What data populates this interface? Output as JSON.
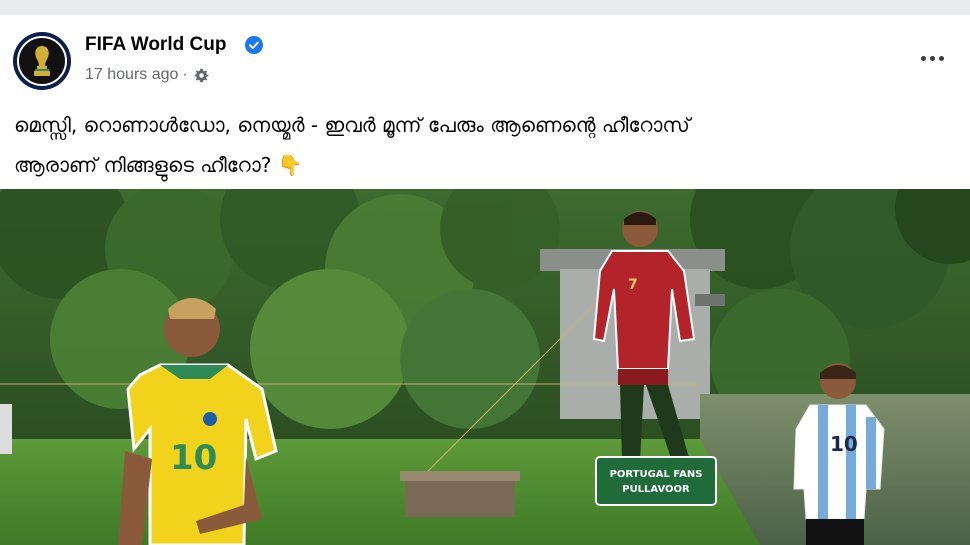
{
  "post": {
    "page_name": "FIFA World Cup",
    "time": "17 hours ago",
    "separator": "·",
    "audience_icon": "gear-icon",
    "verified_icon": "verified-badge-icon",
    "more_icon": "more-options-icon",
    "text_line1": "മെസ്സി, റൊണാൾഡോ, നെയ്മർ - ഇവർ മൂന്ന് പേരും ആണെന്റെ ഹീറോസ്",
    "text_line2": "ആരാണ് നിങ്ങളുടെ ഹീറോ?",
    "emoji": "👇"
  },
  "photo": {
    "sign_line1": "PORTUGAL FANS",
    "sign_line2": "PULLAVOOR",
    "shirt_number_brazil": "10",
    "shirt_number_portugal": "7",
    "shirt_number_argentina": "10",
    "colors": {
      "brazil_yellow": "#f2d31b",
      "portugal_red": "#b3232a",
      "argentina_blue": "#75aadb",
      "forest": "#2f5a26"
    }
  },
  "colors": {
    "background": "#e9ebee",
    "card": "#ffffff",
    "text_primary": "#050505",
    "text_secondary": "#65676b",
    "verified_blue": "#1877f2"
  }
}
